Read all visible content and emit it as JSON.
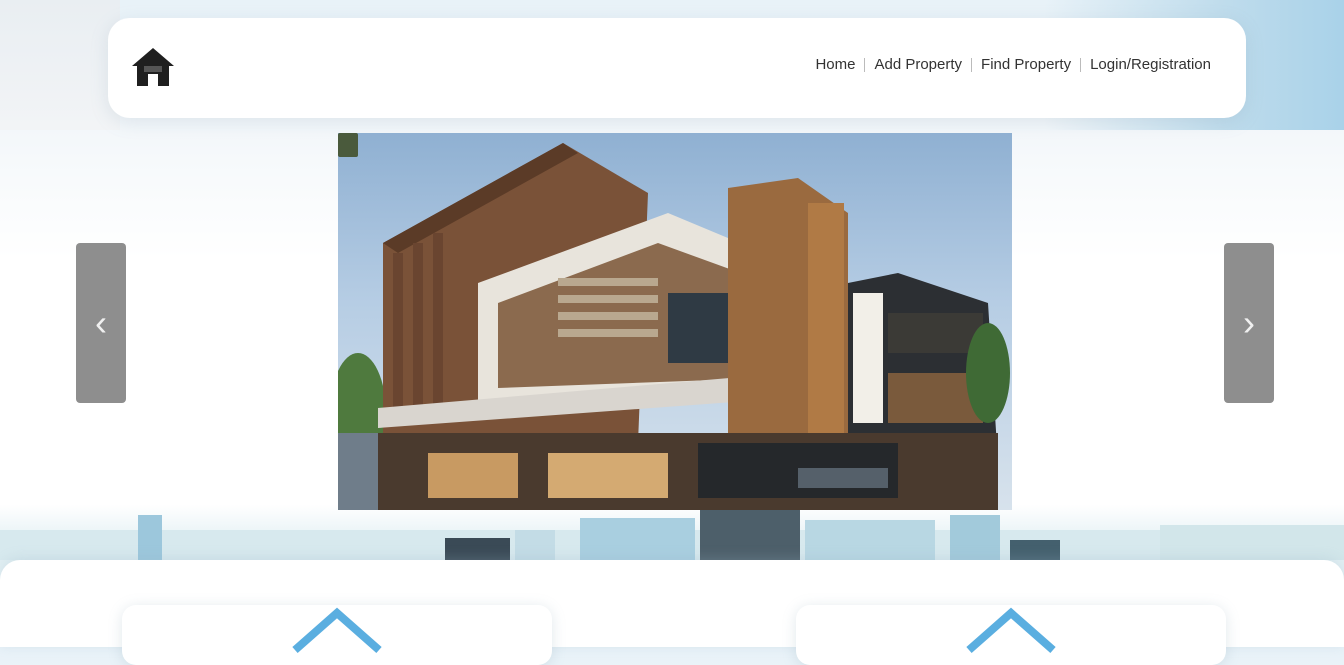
{
  "nav": {
    "links": [
      {
        "label": "Home"
      },
      {
        "label": "Add Property"
      },
      {
        "label": "Find Property"
      },
      {
        "label": "Login/Registration"
      }
    ]
  },
  "slider": {
    "prev_glyph": "‹",
    "next_glyph": "›"
  },
  "icons": {
    "logo": "house-logo-icon",
    "card_icon": "roof-outline-icon"
  },
  "colors": {
    "accent_blue": "#5aaee0",
    "arrow_bg": "#8e8e8e",
    "navbar_bg": "#ffffff"
  }
}
